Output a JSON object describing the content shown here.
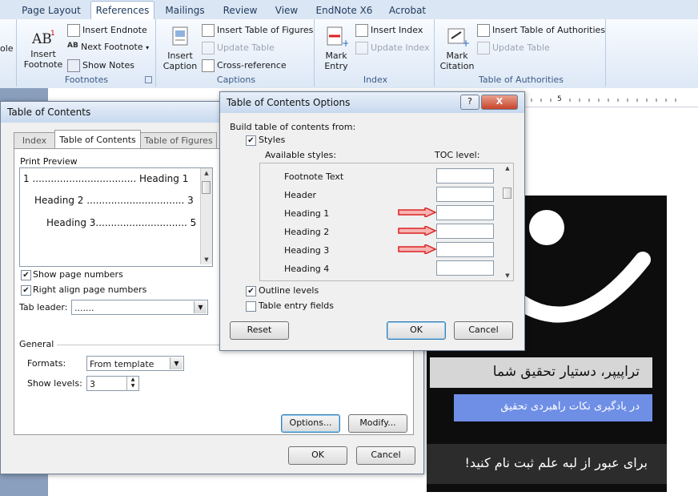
{
  "ribbon": {
    "tabs": [
      "Page Layout",
      "References",
      "Mailings",
      "Review",
      "View",
      "EndNote X6",
      "Acrobat"
    ],
    "active_tab": "References",
    "left_cut_label": "ole",
    "footnotes": {
      "insert_footnote": "Insert\nFootnote",
      "insert_endnote": "Insert Endnote",
      "next_footnote": "Next Footnote",
      "show_notes": "Show Notes",
      "group_label": "Footnotes"
    },
    "captions": {
      "insert_caption": "Insert\nCaption",
      "insert_table_of_figures": "Insert Table of Figures",
      "update_table": "Update Table",
      "cross_reference": "Cross-reference",
      "group_label": "Captions"
    },
    "index": {
      "mark_entry": "Mark\nEntry",
      "insert_index": "Insert Index",
      "update_index": "Update Index",
      "group_label": "Index"
    },
    "authorities": {
      "mark_citation": "Mark\nCitation",
      "insert_table_of_authorities": "Insert Table of Authorities",
      "update_table": "Update Table",
      "group_label": "Table of Authorities"
    }
  },
  "ruler": {
    "mark": "5"
  },
  "toc_dialog": {
    "title": "Table of Contents",
    "tabs": [
      "Index",
      "Table of Contents",
      "Table of Figures"
    ],
    "print_preview_label": "Print Preview",
    "preview_lines": [
      "1 .................................. Heading 1",
      "Heading 2 ................................ 3",
      "Heading 3.............................. 5"
    ],
    "show_page_numbers": "Show page numbers",
    "right_align": "Right align page numbers",
    "tab_leader_label": "Tab leader:",
    "tab_leader_value": ".......",
    "general_label": "General",
    "formats_label": "Formats:",
    "formats_value": "From template",
    "show_levels_label": "Show levels:",
    "show_levels_value": "3",
    "options_button": "Options...",
    "modify_button": "Modify...",
    "ok_button": "OK",
    "cancel_button": "Cancel"
  },
  "options_dialog": {
    "title": "Table of Contents Options",
    "help_button": "?",
    "close_button": "X",
    "build_from": "Build table of contents from:",
    "styles_label": "Styles",
    "available_styles": "Available styles:",
    "toc_level": "TOC level:",
    "styles": [
      {
        "name": "Footnote Text",
        "level": ""
      },
      {
        "name": "Header",
        "level": ""
      },
      {
        "name": "Heading 1",
        "level": ""
      },
      {
        "name": "Heading 2",
        "level": ""
      },
      {
        "name": "Heading 3",
        "level": ""
      },
      {
        "name": "Heading 4",
        "level": ""
      }
    ],
    "outline_levels": "Outline levels",
    "table_entry_fields": "Table entry fields",
    "reset_button": "Reset",
    "ok_button": "OK",
    "cancel_button": "Cancel"
  },
  "banner": {
    "line1": "تراپیپر، دستیار تحقیق شما",
    "line2": "در یادگیری نکات راهبردی تحقیق",
    "line3": "برای عبور از لبه علم ثبت نام کنید!"
  }
}
